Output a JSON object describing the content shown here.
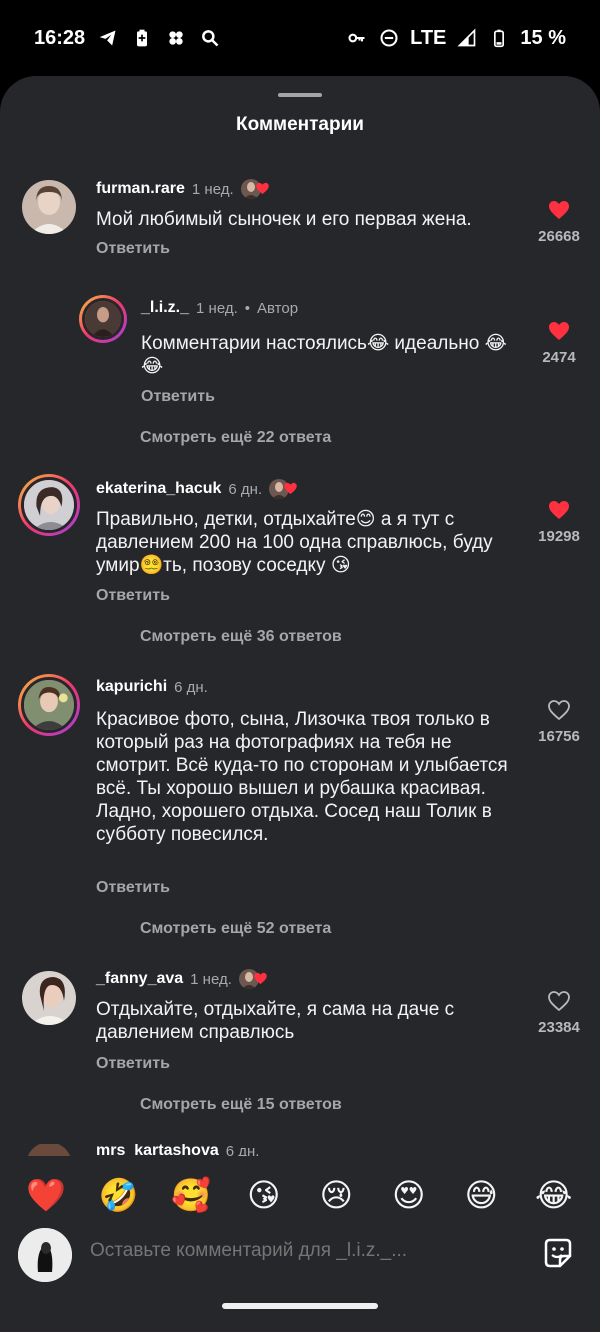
{
  "status_bar": {
    "time": "16:28",
    "network": "LTE",
    "battery": "15 %"
  },
  "sheet": {
    "title": "Комментарии"
  },
  "comments": [
    {
      "username": "furman.rare",
      "time": "1 нед.",
      "text": "Мой любимый сыночек и его первая жена.",
      "reply_label": "Ответить",
      "likes": "26668",
      "liked": true,
      "author_liked": true
    },
    {
      "username": "_l.i.z._",
      "time": "1 нед.",
      "author_tag": "Автор",
      "text": "Комментарии настоялись😂 идеально 😂😂",
      "reply_label": "Ответить",
      "likes": "2474",
      "liked": true,
      "more_replies": "Смотреть ещё 22 ответа"
    },
    {
      "username": "ekaterina_hacuk",
      "time": "6 дн.",
      "text": "Правильно, детки, отдыхайте😊 а я тут с давлением 200 на 100 одна справлюсь, буду умир😵‍💫ть, позову соседку 😘",
      "reply_label": "Ответить",
      "likes": "19298",
      "liked": true,
      "author_liked": true,
      "more_replies": "Смотреть ещё 36 ответов"
    },
    {
      "username": "kapurichi",
      "time": "6 дн.",
      "text": "Красивое фото, сына, Лизочка твоя только в который раз на фотографиях на тебя не смотрит. Всё куда-то по сторонам и улыбается всё. Ты хорошо вышел и рубашка красивая. Ладно, хорошего отдыха. Сосед наш Толик в субботу повесился.",
      "reply_label": "Ответить",
      "likes": "16756",
      "liked": false,
      "more_replies": "Смотреть ещё 52 ответа"
    },
    {
      "username": "_fanny_ava",
      "time": "1 нед.",
      "text": "Отдыхайте, отдыхайте, я сама на даче с давлением справлюсь",
      "reply_label": "Ответить",
      "likes": "23384",
      "liked": false,
      "author_liked": true,
      "more_replies": "Смотреть ещё 15 ответов"
    },
    {
      "username": "mrs_kartashova",
      "time": "6 дн."
    }
  ],
  "reactions": [
    "❤️",
    "🤣",
    "🥰",
    "😘",
    "😢",
    "😍",
    "😅",
    "😂"
  ],
  "composer": {
    "placeholder": "Оставьте комментарий для _l.i.z._..."
  },
  "colors": {
    "heart": "#ff3040",
    "sheet": "#26272b",
    "muted": "#a8a8ad"
  }
}
